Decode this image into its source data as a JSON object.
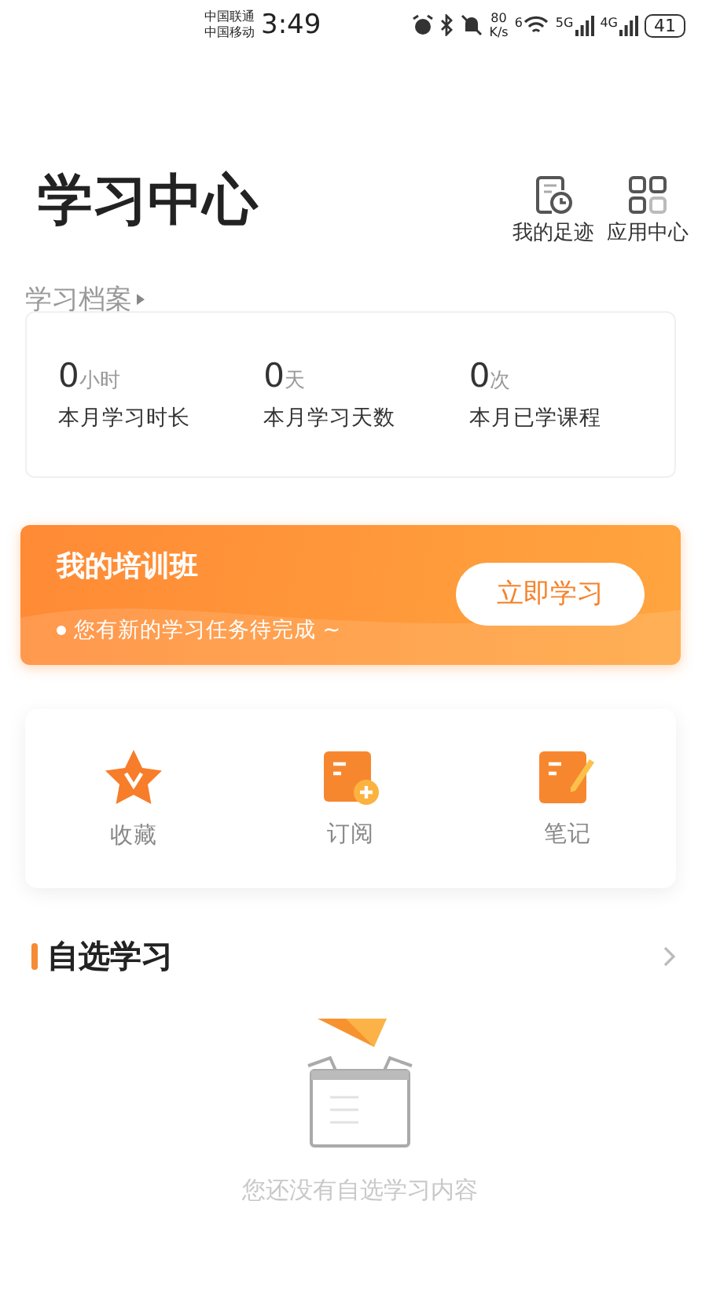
{
  "status_bar": {
    "carriers": [
      "中国联通",
      "中国移动"
    ],
    "time": "3:49",
    "speed": [
      "80",
      "K/s"
    ],
    "wifi_label": "6",
    "signals": [
      "5G",
      "4G"
    ],
    "battery": "41"
  },
  "header": {
    "title": "学习中心",
    "actions": [
      {
        "kind": "history",
        "label": "我的足迹"
      },
      {
        "kind": "apps",
        "label": "应用中心"
      }
    ]
  },
  "archive": {
    "title": "学习档案",
    "stats": [
      {
        "value": "0",
        "unit": "小时",
        "label": "本月学习时长"
      },
      {
        "value": "0",
        "unit": "天",
        "label": "本月学习天数"
      },
      {
        "value": "0",
        "unit": "次",
        "label": "本月已学课程"
      }
    ]
  },
  "banner": {
    "title": "我的培训班",
    "subtitle": "您有新的学习任务待完成 ~",
    "button": "立即学习"
  },
  "shortcuts": [
    {
      "kind": "star",
      "label": "收藏"
    },
    {
      "kind": "subscribe",
      "label": "订阅"
    },
    {
      "kind": "note",
      "label": "笔记"
    }
  ],
  "self_study": {
    "title": "自选学习",
    "empty_text": "您还没有自选学习内容"
  }
}
